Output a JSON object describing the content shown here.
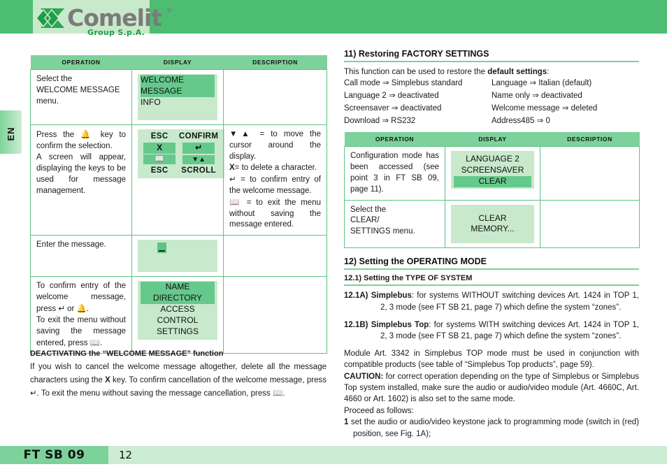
{
  "header": {
    "brand": "Comelit",
    "brand_registered": "®",
    "brand_sub": "Group S.p.A.",
    "band_color": "#4dbd72",
    "panel_color": "#c8e9ca"
  },
  "language_tab": {
    "label": "EN"
  },
  "left_table": {
    "columns": [
      "OPERATION",
      "DISPLAY",
      "DESCRIPTION"
    ],
    "rows": [
      {
        "operation": "Select the\nWELCOME MESSAGE\nmenu.",
        "operation_lines": [
          "Select the",
          "WELCOME MESSAGE",
          "menu."
        ],
        "display": {
          "type": "menu",
          "lines": [
            "WELCOME MESSAGE",
            "INFO"
          ],
          "highlighted": 0,
          "align": "left"
        },
        "description": ""
      },
      {
        "operation_lines": [
          "Press the  ♫  key to confirm the selection.",
          "A screen will appear, displaying the keys to be used for message management."
        ],
        "display": {
          "type": "keypad",
          "labels_top": [
            "ESC",
            "CONFIRM"
          ],
          "keys_row1": [
            "X",
            "↵"
          ],
          "keys_row2": [
            "book",
            "▼▲"
          ],
          "labels_bottom": [
            "ESC",
            "SCROLL"
          ]
        },
        "description_lines": [
          "▼▲ = to move the cursor around the display.",
          "X= to delete a character.",
          "↵ = to confirm entry of the welcome message.",
          "book = to exit the menu without saving the message entered."
        ]
      },
      {
        "operation_lines": [
          "Enter the message."
        ],
        "display": {
          "type": "cursor"
        },
        "description": ""
      },
      {
        "operation_lines": [
          "To confirm entry of the welcome message, press ↵ or bell.",
          "To exit the menu without saving the message entered, press book."
        ],
        "display": {
          "type": "menu",
          "lines": [
            "NAME DIRECTORY",
            "ACCESS CONTROL",
            "SETTINGS"
          ],
          "highlighted": 0,
          "align": "center"
        },
        "description": ""
      }
    ]
  },
  "deactivating": {
    "title": "DEACTIVATING the “WELCOME MESSAGE” function",
    "body_pre": "If you wish to cancel the welcome message altogether, delete all the message characters using the ",
    "key_x": "X",
    "body_mid": " key. To confirm cancellation of the welcome message, press ",
    "body_mid2": ". To exit the menu without saving the message cancellation, press ",
    "body_end": "."
  },
  "section11": {
    "heading": "11) Restoring FACTORY SETTINGS",
    "intro_pre": "This function can be used to restore the ",
    "intro_bold": "default settings",
    "intro_post": ":",
    "defaults_left": [
      "Call mode ⇒ Simplebus standard",
      "Language 2 ⇒ deactivated",
      "Screensaver ⇒ deactivated",
      "Download ⇒ RS232"
    ],
    "defaults_right": [
      "Language ⇒ Italian (default)",
      "Name only ⇒ deactivated",
      "Welcome message ⇒ deleted",
      "Address485 ⇒ 0"
    ]
  },
  "right_table": {
    "columns": [
      "OPERATION",
      "DISPLAY",
      "DESCRIPTION"
    ],
    "rows": [
      {
        "operation": "Configuration mode has been accessed (see point 3 in FT SB 09, page 11).",
        "display": {
          "type": "menu",
          "lines": [
            "LANGUAGE 2",
            "SCREENSAVER",
            "CLEAR"
          ],
          "highlighted": 2,
          "align": "center"
        },
        "description": ""
      },
      {
        "operation_lines": [
          "Select the",
          "CLEAR/",
          "SETTINGS menu."
        ],
        "display": {
          "type": "menu",
          "lines": [
            "CLEAR",
            "MEMORY..."
          ],
          "highlighted": -1,
          "align": "center"
        },
        "description": ""
      }
    ]
  },
  "section12": {
    "heading": "12) Setting the OPERATING MODE",
    "sub_heading": "12.1) Setting the TYPE OF SYSTEM",
    "items": [
      {
        "lead": "12.1A) Simplebus",
        "text": ": for systems WITHOUT switching devices Art. 1424 in TOP 1, 2, 3 mode (see FT SB 21, page 7) which define the system “zones”."
      },
      {
        "lead": "12.1B) Simplebus Top",
        "text": ": for systems WITH switching devices Art. 1424 in TOP 1, 2, 3 mode (see FT SB 21, page 7) which define the system “zones”."
      }
    ],
    "module_note": "Module Art. 3342 in Simplebus TOP mode must be used in conjunction with compatible products (see table of “Simplebus Top products”, page 59).",
    "caution_label": "CAUTION:",
    "caution_text": " for correct operation depending on the type of Simplebus or Simplebus Top system installed, make sure the audio or audio/video module (Art. 4660C, Art. 4660 or Art. 1602) is also set to the same mode.",
    "proceed": "Proceed as follows:",
    "step1_num": "1",
    "step1_text": "set the audio or audio/video keystone jack to programming mode (switch in (red) position, see Fig. 1A);"
  },
  "footer": {
    "doc_code": "FT SB 09",
    "page_number": "12"
  }
}
